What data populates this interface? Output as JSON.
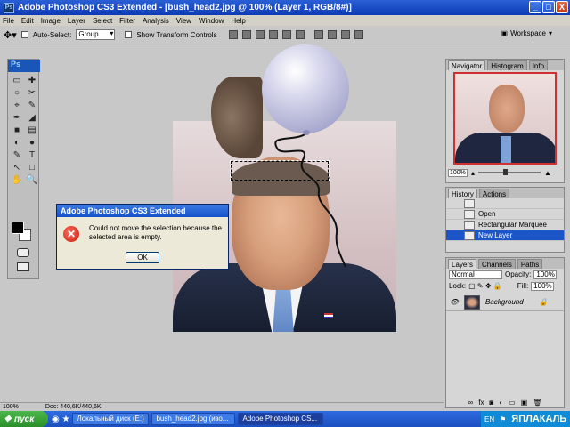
{
  "window": {
    "title": "Adobe Photoshop CS3 Extended - [bush_head2.jpg @ 100% (Layer 1, RGB/8#)]",
    "app_badge": "Ps",
    "minimize": "_",
    "maximize": "□",
    "close": "X"
  },
  "menu": [
    "File",
    "Edit",
    "Image",
    "Layer",
    "Select",
    "Filter",
    "Analysis",
    "View",
    "Window",
    "Help"
  ],
  "options": {
    "auto_select_label": "Auto-Select:",
    "auto_select_value": "Group",
    "show_transform_label": "Show Transform Controls",
    "workspace_label": "Workspace"
  },
  "tools": {
    "logo": "Ps",
    "items": [
      "▭",
      "✚",
      "○",
      "✂",
      "⌖",
      "✎",
      "✒",
      "◢",
      "■",
      "▤",
      "◐",
      "●",
      "✎",
      "T",
      "↖",
      "□",
      "✋",
      "🔍"
    ]
  },
  "dialog": {
    "title": "Adobe Photoshop CS3 Extended",
    "message": "Could not move the selection because the selected area is empty.",
    "ok": "OK",
    "error_icon": "✕"
  },
  "navigator": {
    "tabs": [
      "Navigator",
      "Histogram",
      "Info"
    ],
    "zoom": "100%"
  },
  "history": {
    "tabs": [
      "History",
      "Actions"
    ],
    "items": [
      "Open",
      "Rectangular Marquee",
      "New Layer"
    ],
    "selected_index": 2
  },
  "layers": {
    "tabs": [
      "Layers",
      "Channels",
      "Paths"
    ],
    "blend_mode": "Normal",
    "opacity_label": "Opacity:",
    "opacity": "100%",
    "lock_label": "Lock:",
    "fill_label": "Fill:",
    "fill": "100%",
    "layer_name": "Background"
  },
  "status": {
    "zoom": "100%",
    "doc": "Doc: 440,6K/440,6K"
  },
  "taskbar": {
    "start": "пуск",
    "tasks": [
      "Локальный диск (E:)",
      "bush_head2.jpg (изо...",
      "Adobe Photoshop CS..."
    ],
    "active_index": 2,
    "lang": "EN",
    "brand": "ЯПЛАКАЛЬ"
  }
}
